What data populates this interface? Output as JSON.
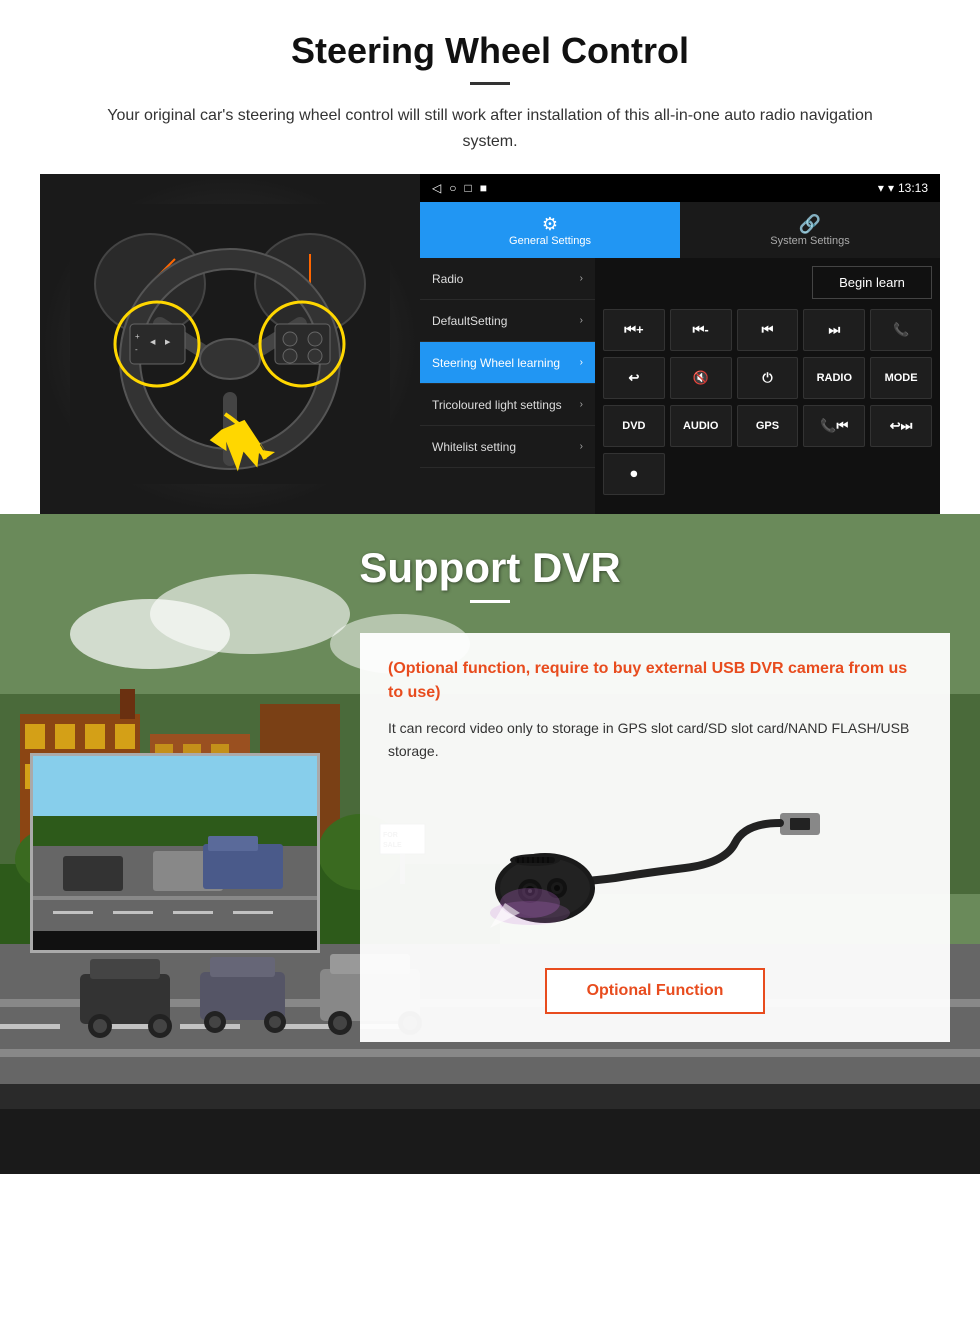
{
  "page": {
    "swc_section": {
      "title": "Steering Wheel Control",
      "subtitle": "Your original car's steering wheel control will still work after installation of this all-in-one auto radio navigation system.",
      "statusbar": {
        "time": "13:13",
        "icons": [
          "◁",
          "○",
          "□",
          "■"
        ]
      },
      "tabs": {
        "general": {
          "label": "General Settings",
          "icon": "⚙"
        },
        "system": {
          "label": "System Settings",
          "icon": "🔗"
        }
      },
      "menu_items": [
        {
          "label": "Radio",
          "active": false
        },
        {
          "label": "DefaultSetting",
          "active": false
        },
        {
          "label": "Steering Wheel learning",
          "active": true
        },
        {
          "label": "Tricoloured light settings",
          "active": false
        },
        {
          "label": "Whitelist setting",
          "active": false
        }
      ],
      "begin_learn": "Begin learn",
      "control_buttons_row1": [
        "⏮+",
        "⏮-",
        "⏮",
        "⏭",
        "📞"
      ],
      "control_buttons_row2": [
        "↩",
        "🔇",
        "⏻",
        "RADIO",
        "MODE"
      ],
      "control_buttons_row3": [
        "DVD",
        "AUDIO",
        "GPS",
        "📞⏮",
        "↩⏭"
      ],
      "control_buttons_row4": [
        "⏺"
      ]
    },
    "dvr_section": {
      "title": "Support DVR",
      "optional_text": "(Optional function, require to buy external USB DVR camera from us to use)",
      "description": "It can record video only to storage in GPS slot card/SD slot card/NAND FLASH/USB storage.",
      "optional_function_btn": "Optional Function"
    }
  }
}
